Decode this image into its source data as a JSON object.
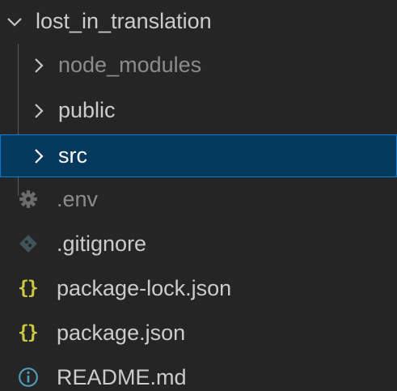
{
  "explorer": {
    "root": {
      "label": "lost_in_translation",
      "expanded": true,
      "icon": "chevron-down-icon"
    },
    "items": [
      {
        "label": "node_modules",
        "type": "folder",
        "expanded": false,
        "dimmed": true,
        "icon": "chevron-right-icon"
      },
      {
        "label": "public",
        "type": "folder",
        "expanded": false,
        "dimmed": false,
        "icon": "chevron-right-icon"
      },
      {
        "label": "src",
        "type": "folder",
        "expanded": false,
        "selected": true,
        "icon": "chevron-right-icon"
      },
      {
        "label": ".env",
        "type": "file",
        "dimmed": true,
        "icon": "gear-icon"
      },
      {
        "label": ".gitignore",
        "type": "file",
        "icon": "git-diamond-icon"
      },
      {
        "label": "package-lock.json",
        "type": "file",
        "icon": "json-braces-icon",
        "icon_text": "{}"
      },
      {
        "label": "package.json",
        "type": "file",
        "icon": "json-braces-icon",
        "icon_text": "{}"
      },
      {
        "label": "README.md",
        "type": "file",
        "icon": "info-icon"
      }
    ]
  },
  "colors": {
    "background": "#252526",
    "text": "#cccccc",
    "dimmed_text": "#8c8c8c",
    "selected_background": "#04395e",
    "selected_border": "#007fd4",
    "json_icon": "#cbcb41",
    "info_icon": "#519aba"
  }
}
